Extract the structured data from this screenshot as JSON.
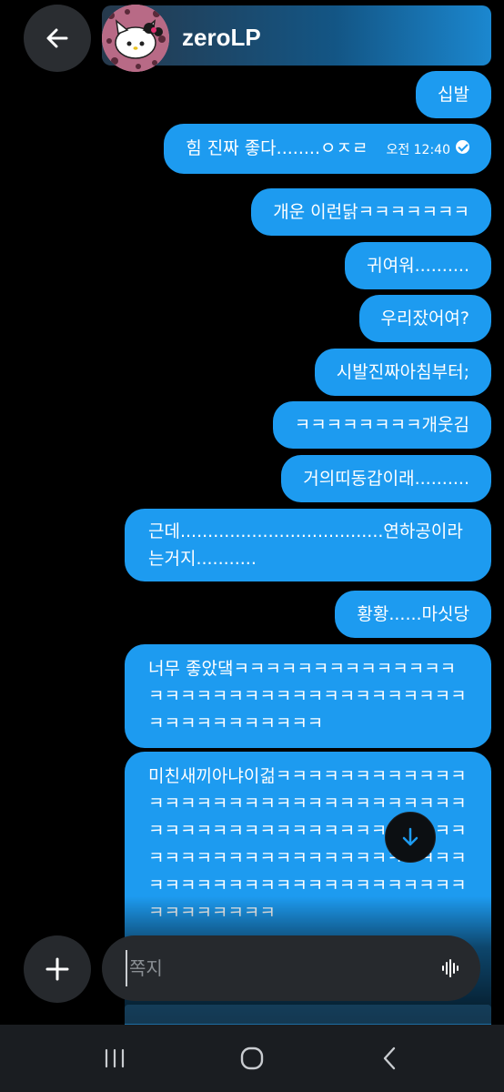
{
  "header": {
    "username": "zeroLP",
    "back_icon": "arrow-left-icon",
    "avatar": "hello-kitty-avatar"
  },
  "messages": [
    {
      "text": "십발"
    },
    {
      "text": "힘 진짜 좋다........ㅇㅈㄹ",
      "time": "오전 12:40",
      "status": "check-circle-icon"
    },
    {
      "text": "개운 이런닭ㅋㅋㅋㅋㅋㅋㅋ"
    },
    {
      "text": "귀여워.........."
    },
    {
      "text": "우리잤어여?"
    },
    {
      "text": "시발진짜아침부터;"
    },
    {
      "text": "ㅋㅋㅋㅋㅋㅋㅋㅋ개웃김"
    },
    {
      "text": "거의띠동갑이래.........."
    },
    {
      "text": "근데.....................................연하공이라는거지..........."
    },
    {
      "text": "황황......마싯당"
    },
    {
      "text": "너무 좋았댘ㅋㅋㅋㅋㅋㅋㅋㅋㅋㅋㅋㅋㅋㅋㅋㅋㅋㅋㅋㅋㅋㅋㅋㅋㅋㅋㅋㅋㅋㅋㅋㅋㅋㅋㅋㅋㅋㅋㅋㅋㅋㅋㅋㅋㅋ"
    },
    {
      "text": "미친새끼아냐이걺ㅋㅋㅋㅋㅋㅋㅋㅋㅋㅋㅋㅋㅋㅋㅋㅋㅋㅋㅋㅋㅋㅋㅋㅋㅋㅋㅋㅋㅋㅋㅋㅋㅋㅋㅋㅋㅋㅋㅋㅋㅋㅋㅋㅋㅋㅋㅋㅋㅋㅋㅋㅋㅋㅋㅋㅋㅋㅋㅋㅋㅋㅋㅋㅋㅋㅋㅋㅋㅋㅋㅋㅋㅋㅋㅋㅋㅋㅋㅋㅋㅋㅋㅋㅋㅋㅋㅋㅋㅋㅋㅋㅋㅋㅋㅋㅋㅋㅋㅋㅋ"
    }
  ],
  "composer": {
    "placeholder": "쪽지",
    "plus_icon": "plus-icon",
    "voice_icon": "voice-waveform-icon"
  },
  "scroll_button_icon": "arrow-down-icon",
  "nav": {
    "recents_icon": "recents-icon",
    "home_icon": "home-icon",
    "back_icon": "back-chevron-icon"
  },
  "colors": {
    "bubble": "#1d9bf0",
    "background": "#000000"
  }
}
